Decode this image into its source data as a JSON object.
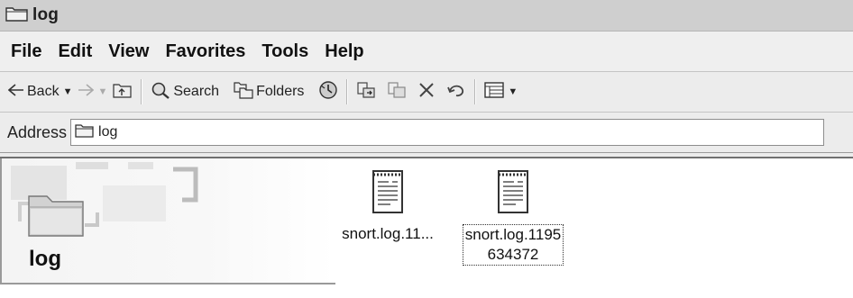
{
  "window": {
    "title": "log"
  },
  "menu": {
    "items": [
      "File",
      "Edit",
      "View",
      "Favorites",
      "Tools",
      "Help"
    ]
  },
  "toolbar": {
    "back_label": "Back",
    "search_label": "Search",
    "folders_label": "Folders"
  },
  "address": {
    "label": "Address",
    "value": "log"
  },
  "folder_panel": {
    "title": "log"
  },
  "files": [
    {
      "name": "snort.log.11..."
    },
    {
      "name_line1": "snort.log.1195",
      "name_line2": "634372"
    }
  ]
}
